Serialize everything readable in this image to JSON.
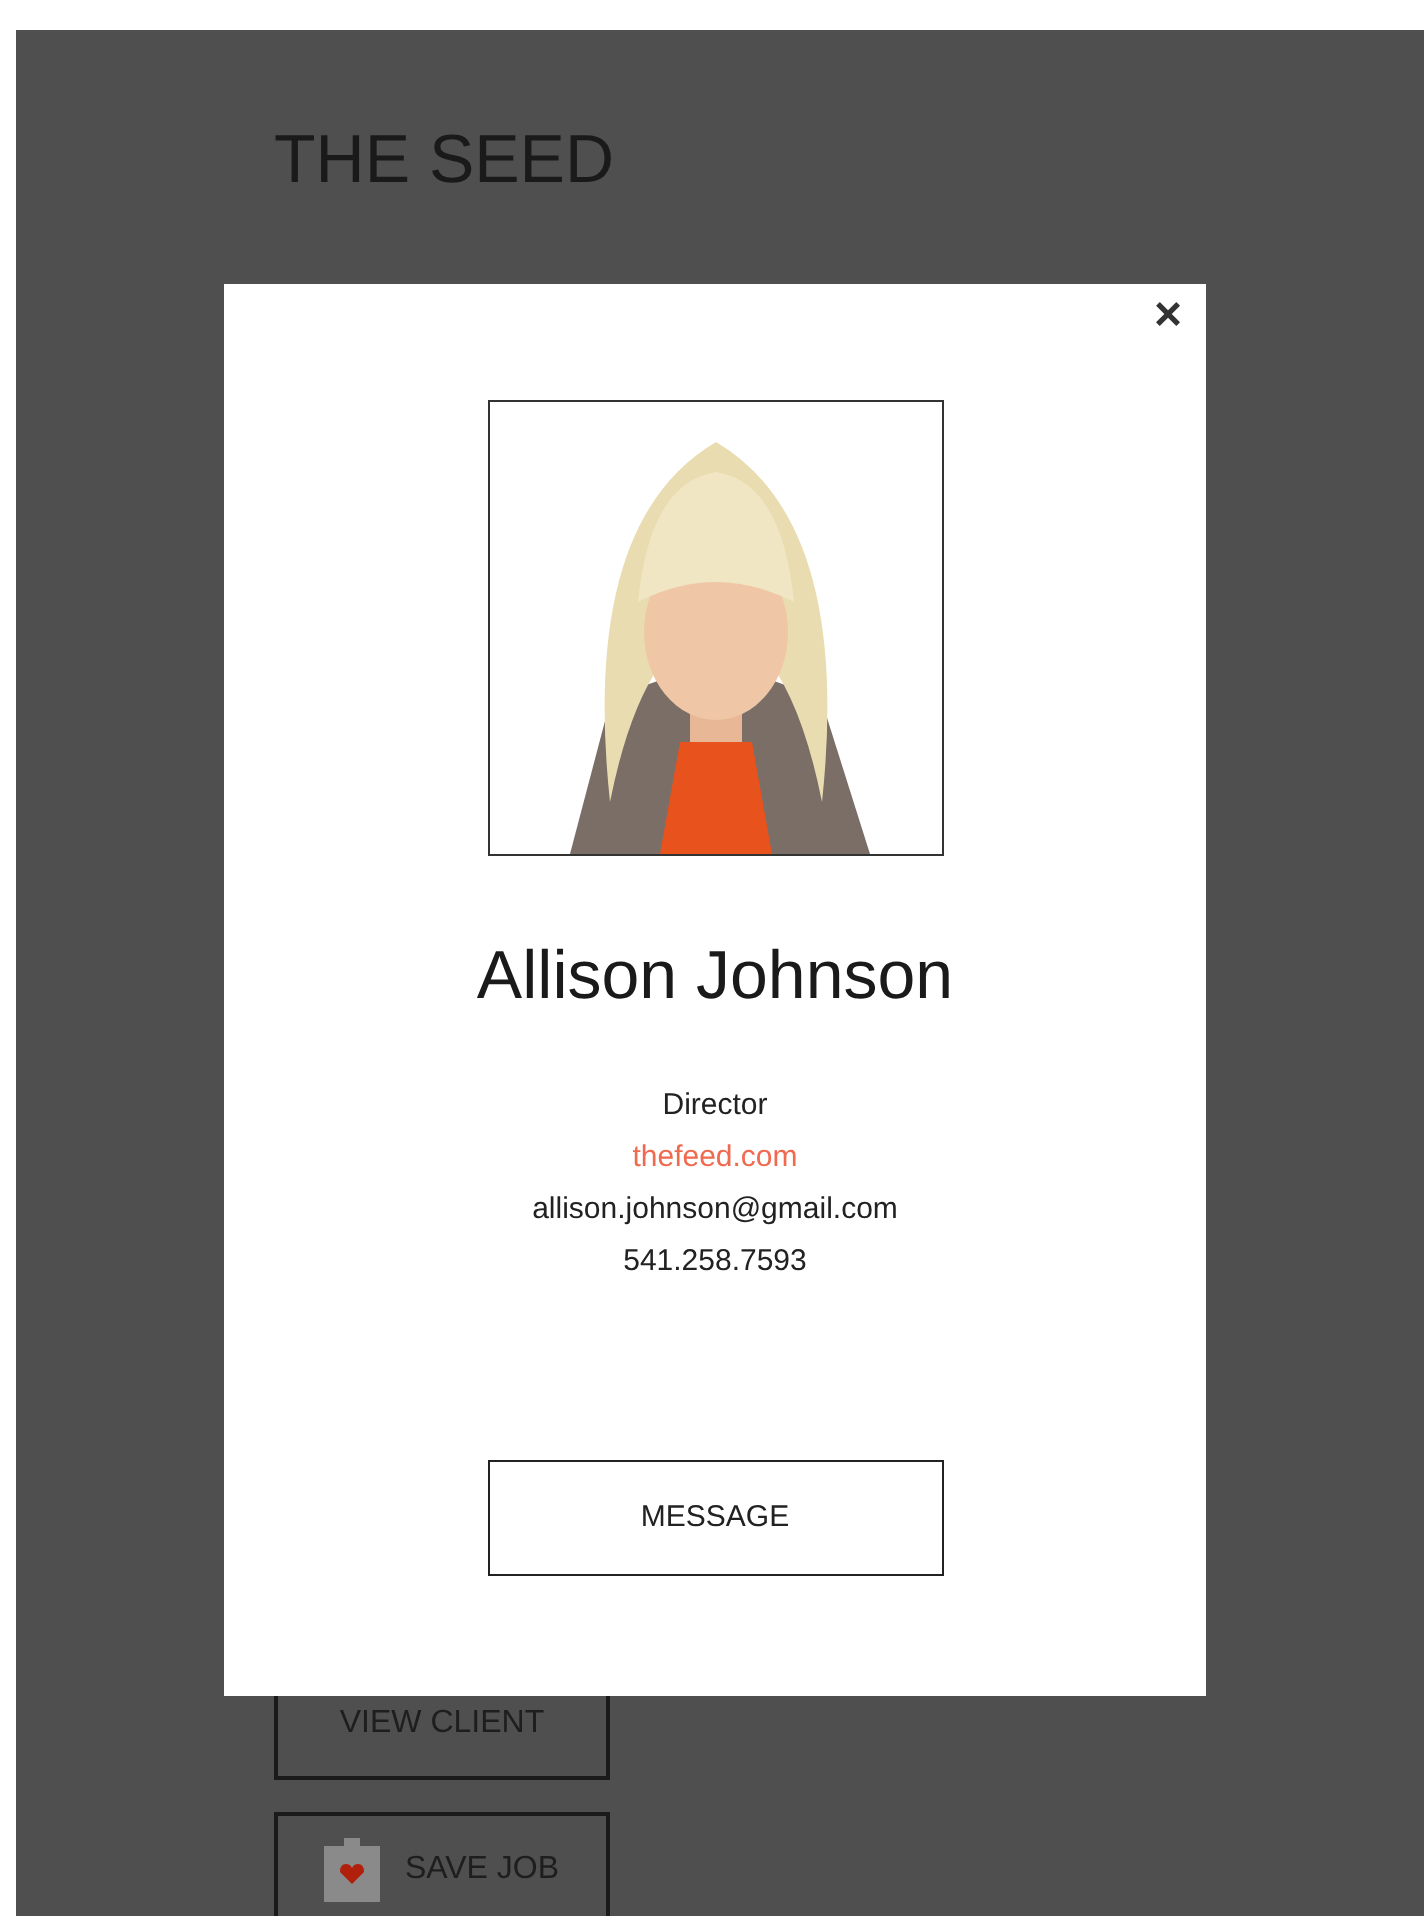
{
  "page": {
    "title": "THE SEED"
  },
  "actions": [
    {
      "label": "VIEW CLIENT",
      "kind": "plain"
    },
    {
      "label": "SAVE JOB",
      "kind": "save"
    }
  ],
  "modal": {
    "close": "×",
    "name": "Allison Johnson",
    "role": "Director",
    "website": "thefeed.com",
    "email": "allison.johnson@gmail.com",
    "phone": "541.258.7593",
    "button": "MESSAGE"
  }
}
